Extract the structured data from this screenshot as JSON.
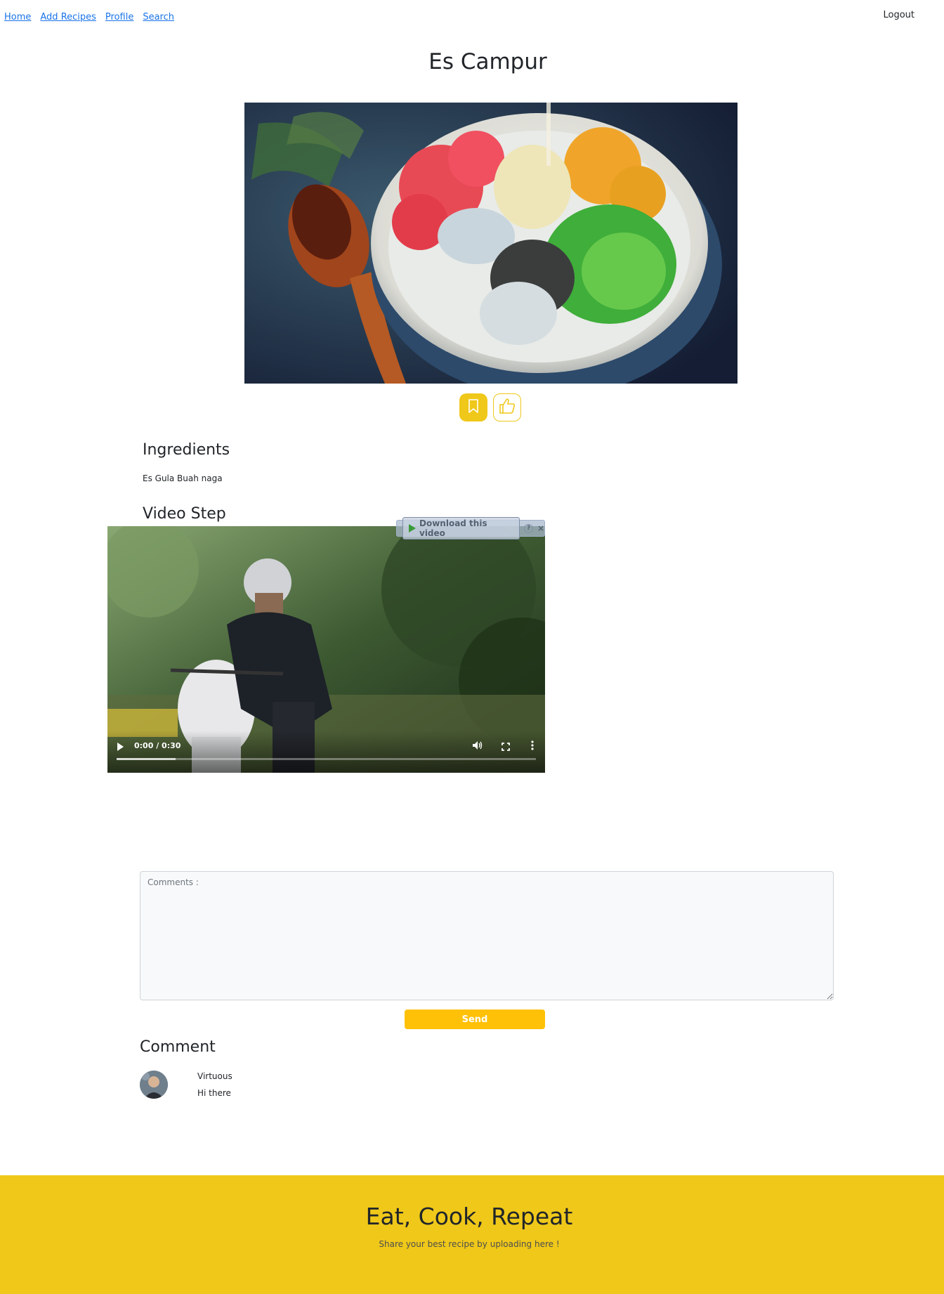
{
  "nav": {
    "links": [
      {
        "label": "Home"
      },
      {
        "label": "Add Recipes"
      },
      {
        "label": "Profile"
      },
      {
        "label": "Search"
      }
    ],
    "logout_label": "Logout"
  },
  "recipe": {
    "title": "Es Campur",
    "image_icon": "recipe-photo",
    "actions": {
      "bookmark_icon": "bookmark-icon",
      "like_icon": "thumbs-up-icon"
    },
    "ingredients_heading": "Ingredients",
    "ingredients_text": "Es Gula Buah naga",
    "video_heading": "Video Step"
  },
  "video": {
    "time": "0:00 / 0:30",
    "progress_buffered": 0.14,
    "download_label": "Download this video",
    "help_label": "?",
    "close_label": "×"
  },
  "comment_form": {
    "placeholder": "Comments :",
    "send_label": "Send"
  },
  "comments": {
    "heading": "Comment",
    "items": [
      {
        "name": "Virtuous",
        "text": "Hi there"
      }
    ]
  },
  "footer": {
    "title": "Eat, Cook, Repeat",
    "subtitle": "Share your best recipe by uploading here !"
  },
  "colors": {
    "accent": "#efc81a",
    "send_button": "#ffc107",
    "link": "#1a73e8"
  }
}
